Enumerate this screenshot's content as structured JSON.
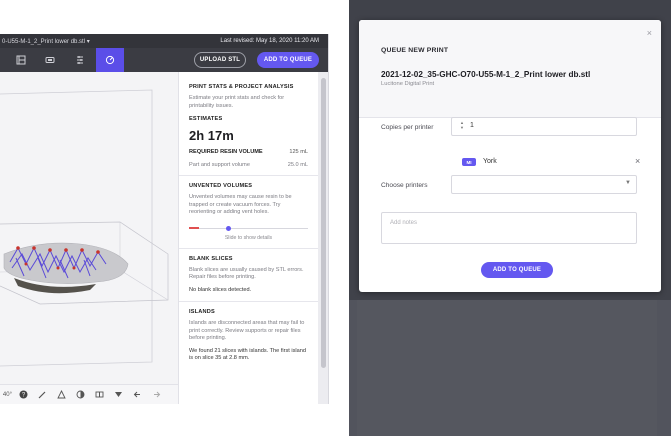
{
  "left_panel": {
    "file_name": "0-U55-M-1_2_Print lower db.stl",
    "file_caret": "▾",
    "last_revised": "Last revised: May 18, 2020 11:20 AM",
    "toolbar": {
      "active_tool": "stats",
      "upload_label": "UPLOAD STL",
      "queue_label": "ADD TO QUEUE"
    },
    "bottom": {
      "angle": "40°"
    },
    "stats": {
      "title": "PRINT STATS & PROJECT ANALYSIS",
      "subtitle": "Estimate your print stats and check for printability issues.",
      "estimates_title": "ESTIMATES",
      "print_time": "2h 17m",
      "resin_label": "REQUIRED RESIN VOLUME",
      "resin_value": "125 mL",
      "support_label": "Part and support volume",
      "support_value": "25.0 mL",
      "unvented_title": "UNVENTED VOLUMES",
      "unvented_text": "Unvented volumes may cause resin to be trapped or create vacuum forces. Try reorienting or adding vent holes.",
      "slider_caption": "Slide to show details",
      "slider_level": 0.31,
      "blank_title": "BLANK SLICES",
      "blank_text": "Blank slices are usually caused by STL errors. Repair files before printing.",
      "blank_result": "No blank slices detected.",
      "islands_title": "ISLANDS",
      "islands_text": "Islands are disconnected areas that may fail to print correctly. Review supports or repair files before printing.",
      "islands_result": "We found 21 slices with islands. The first island is on slice 35 at 2.8 mm."
    }
  },
  "modal": {
    "title": "QUEUE NEW PRINT",
    "file_name": "2021-12-02_35-GHC-O70-U55-M-1_2_Print lower db.stl",
    "organization": "Lucitone Digital Print",
    "copies_label": "Copies per printer",
    "copies_value": "1",
    "printer_chip": "MI",
    "printer_name": "York",
    "choose_label": "Choose printers",
    "notes_placeholder": "Add notes",
    "add_button": "ADD TO QUEUE",
    "close": "×",
    "remove": "×"
  },
  "colors": {
    "accent": "#6458f0",
    "topbar": "#33343a",
    "model_purple": "#5a4ad8",
    "model_red": "#c8342c",
    "model_grey": "#c8c8cc"
  },
  "icons": [
    "layout-icon",
    "rect-icon",
    "supports-icon",
    "stats-icon",
    "help-icon",
    "pen-icon",
    "cone-icon",
    "contrast-icon",
    "split-icon",
    "cut-icon",
    "arrow-left-icon",
    "arrow-right-icon",
    "close-icon",
    "chevron-down-icon",
    "stepper-icon"
  ]
}
